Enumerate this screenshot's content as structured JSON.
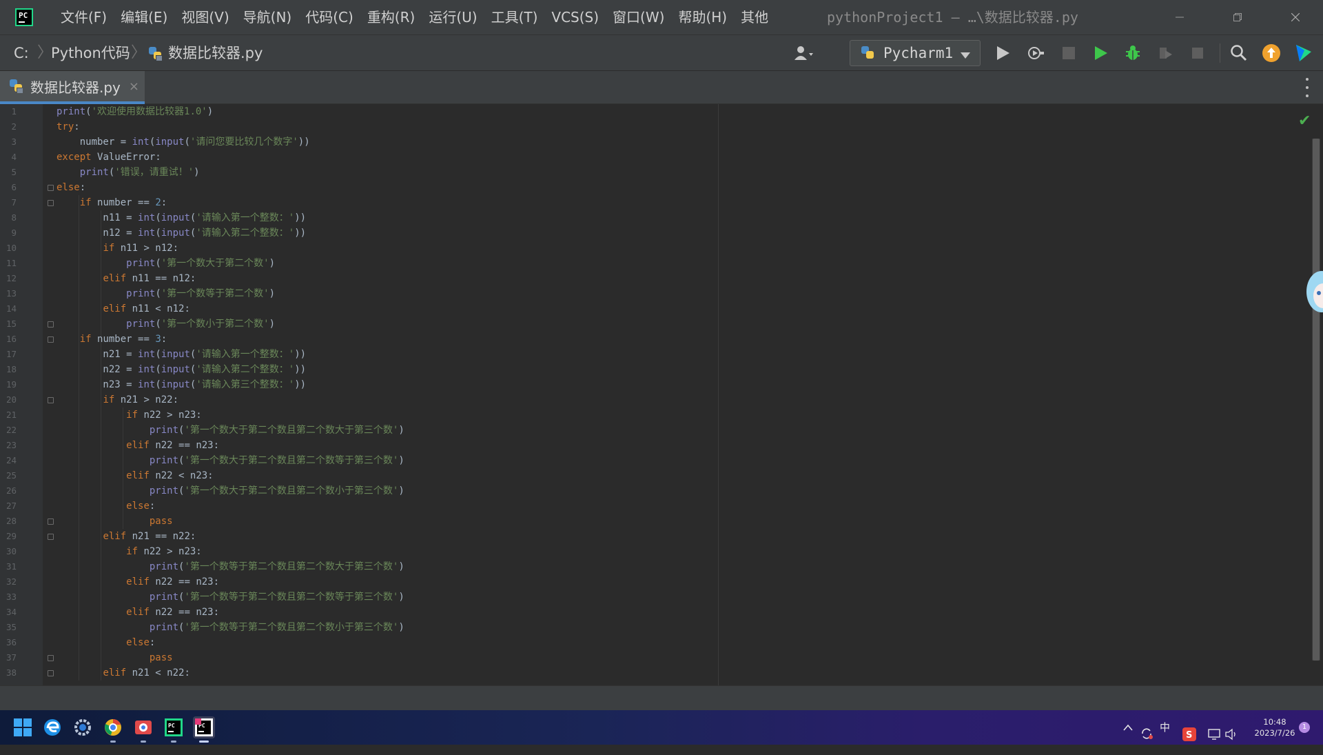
{
  "titlebar": {
    "logo_text": "PC",
    "menu": [
      "文件(F)",
      "编辑(E)",
      "视图(V)",
      "导航(N)",
      "代码(C)",
      "重构(R)",
      "运行(U)",
      "工具(T)",
      "VCS(S)",
      "窗口(W)",
      "帮助(H)",
      "其他"
    ],
    "window_title": "pythonProject1 – …\\数据比较器.py"
  },
  "navbar": {
    "breadcrumb_root": "C:",
    "breadcrumb_folder": "Python代码",
    "breadcrumb_file": "数据比较器.py",
    "run_config": "Pycharm1"
  },
  "tab": {
    "label": "数据比较器.py",
    "close": "×"
  },
  "editor": {
    "line_numbers": [
      "1",
      "2",
      "3",
      "4",
      "5",
      "6",
      "7",
      "8",
      "9",
      "10",
      "11",
      "12",
      "13",
      "14",
      "15",
      "16",
      "17",
      "18",
      "19",
      "20",
      "21",
      "22",
      "23",
      "24",
      "25",
      "26",
      "27",
      "28",
      "29",
      "30",
      "31",
      "32",
      "33",
      "34",
      "35",
      "36",
      "37",
      "38"
    ],
    "lines": [
      [
        [
          "fn",
          "print"
        ],
        [
          "",
          "("
        ],
        [
          "str",
          "'欢迎使用数据比较器1.0'"
        ],
        [
          "",
          ")"
        ]
      ],
      [
        [
          "kw",
          "try"
        ],
        [
          "",
          ":"
        ]
      ],
      [
        [
          "",
          "    number = "
        ],
        [
          "fn",
          "int"
        ],
        [
          "",
          "("
        ],
        [
          "fn",
          "input"
        ],
        [
          "",
          "("
        ],
        [
          "str",
          "'请问您要比较几个数字'"
        ],
        [
          "",
          "))"
        ]
      ],
      [
        [
          "kw",
          "except "
        ],
        [
          "",
          "ValueError:"
        ]
      ],
      [
        [
          "",
          "    "
        ],
        [
          "fn",
          "print"
        ],
        [
          "",
          "("
        ],
        [
          "str",
          "'错误，请重试！'"
        ],
        [
          "",
          ")"
        ]
      ],
      [
        [
          "kw",
          "else"
        ],
        [
          "",
          ":"
        ]
      ],
      [
        [
          "",
          "    "
        ],
        [
          "kw",
          "if "
        ],
        [
          "",
          "number == "
        ],
        [
          "num",
          "2"
        ],
        [
          "",
          ":"
        ]
      ],
      [
        [
          "",
          "        n11 = "
        ],
        [
          "fn",
          "int"
        ],
        [
          "",
          "("
        ],
        [
          "fn",
          "input"
        ],
        [
          "",
          "("
        ],
        [
          "str",
          "'请输入第一个整数：'"
        ],
        [
          "",
          "))"
        ]
      ],
      [
        [
          "",
          "        n12 = "
        ],
        [
          "fn",
          "int"
        ],
        [
          "",
          "("
        ],
        [
          "fn",
          "input"
        ],
        [
          "",
          "("
        ],
        [
          "str",
          "'请输入第二个整数：'"
        ],
        [
          "",
          "))"
        ]
      ],
      [
        [
          "",
          "        "
        ],
        [
          "kw",
          "if "
        ],
        [
          "",
          "n11 > n12:"
        ]
      ],
      [
        [
          "",
          "            "
        ],
        [
          "fn",
          "print"
        ],
        [
          "",
          "("
        ],
        [
          "str",
          "'第一个数大于第二个数'"
        ],
        [
          "",
          ")"
        ]
      ],
      [
        [
          "",
          "        "
        ],
        [
          "kw",
          "elif "
        ],
        [
          "",
          "n11 == n12:"
        ]
      ],
      [
        [
          "",
          "            "
        ],
        [
          "fn",
          "print"
        ],
        [
          "",
          "("
        ],
        [
          "str",
          "'第一个数等于第二个数'"
        ],
        [
          "",
          ")"
        ]
      ],
      [
        [
          "",
          "        "
        ],
        [
          "kw",
          "elif "
        ],
        [
          "",
          "n11 < n12:"
        ]
      ],
      [
        [
          "",
          "            "
        ],
        [
          "fn",
          "print"
        ],
        [
          "",
          "("
        ],
        [
          "str",
          "'第一个数小于第二个数'"
        ],
        [
          "",
          ")"
        ]
      ],
      [
        [
          "",
          "    "
        ],
        [
          "kw",
          "if "
        ],
        [
          "",
          "number == "
        ],
        [
          "num",
          "3"
        ],
        [
          "",
          ":"
        ]
      ],
      [
        [
          "",
          "        n21 = "
        ],
        [
          "fn",
          "int"
        ],
        [
          "",
          "("
        ],
        [
          "fn",
          "input"
        ],
        [
          "",
          "("
        ],
        [
          "str",
          "'请输入第一个整数：'"
        ],
        [
          "",
          "))"
        ]
      ],
      [
        [
          "",
          "        n22 = "
        ],
        [
          "fn",
          "int"
        ],
        [
          "",
          "("
        ],
        [
          "fn",
          "input"
        ],
        [
          "",
          "("
        ],
        [
          "str",
          "'请输入第二个整数：'"
        ],
        [
          "",
          "))"
        ]
      ],
      [
        [
          "",
          "        n23 = "
        ],
        [
          "fn",
          "int"
        ],
        [
          "",
          "("
        ],
        [
          "fn",
          "input"
        ],
        [
          "",
          "("
        ],
        [
          "str",
          "'请输入第三个整数：'"
        ],
        [
          "",
          "))"
        ]
      ],
      [
        [
          "",
          "        "
        ],
        [
          "kw",
          "if "
        ],
        [
          "",
          "n21 > n22:"
        ]
      ],
      [
        [
          "",
          "            "
        ],
        [
          "kw",
          "if "
        ],
        [
          "",
          "n22 > n23:"
        ]
      ],
      [
        [
          "",
          "                "
        ],
        [
          "fn",
          "print"
        ],
        [
          "",
          "("
        ],
        [
          "str",
          "'第一个数大于第二个数且第二个数大于第三个数'"
        ],
        [
          "",
          ")"
        ]
      ],
      [
        [
          "",
          "            "
        ],
        [
          "kw",
          "elif "
        ],
        [
          "",
          "n22 == n23:"
        ]
      ],
      [
        [
          "",
          "                "
        ],
        [
          "fn",
          "print"
        ],
        [
          "",
          "("
        ],
        [
          "str",
          "'第一个数大于第二个数且第二个数等于第三个数'"
        ],
        [
          "",
          ")"
        ]
      ],
      [
        [
          "",
          "            "
        ],
        [
          "kw",
          "elif "
        ],
        [
          "",
          "n22 < n23:"
        ]
      ],
      [
        [
          "",
          "                "
        ],
        [
          "fn",
          "print"
        ],
        [
          "",
          "("
        ],
        [
          "str",
          "'第一个数大于第二个数且第二个数小于第三个数'"
        ],
        [
          "",
          ")"
        ]
      ],
      [
        [
          "",
          "            "
        ],
        [
          "kw",
          "else"
        ],
        [
          "",
          ":"
        ]
      ],
      [
        [
          "",
          "                "
        ],
        [
          "kw",
          "pass"
        ]
      ],
      [
        [
          "",
          "        "
        ],
        [
          "kw",
          "elif "
        ],
        [
          "",
          "n21 == n22:"
        ]
      ],
      [
        [
          "",
          "            "
        ],
        [
          "kw",
          "if "
        ],
        [
          "",
          "n22 > n23:"
        ]
      ],
      [
        [
          "",
          "                "
        ],
        [
          "fn",
          "print"
        ],
        [
          "",
          "("
        ],
        [
          "str",
          "'第一个数等于第二个数且第二个数大于第三个数'"
        ],
        [
          "",
          ")"
        ]
      ],
      [
        [
          "",
          "            "
        ],
        [
          "kw",
          "elif "
        ],
        [
          "",
          "n22 == n23:"
        ]
      ],
      [
        [
          "",
          "                "
        ],
        [
          "fn",
          "print"
        ],
        [
          "",
          "("
        ],
        [
          "str",
          "'第一个数等于第二个数且第二个数等于第三个数'"
        ],
        [
          "",
          ")"
        ]
      ],
      [
        [
          "",
          "            "
        ],
        [
          "kw",
          "elif "
        ],
        [
          "",
          "n22 == n23:"
        ]
      ],
      [
        [
          "",
          "                "
        ],
        [
          "fn",
          "print"
        ],
        [
          "",
          "("
        ],
        [
          "str",
          "'第一个数等于第二个数且第二个数小于第三个数'"
        ],
        [
          "",
          ")"
        ]
      ],
      [
        [
          "",
          "            "
        ],
        [
          "kw",
          "else"
        ],
        [
          "",
          ":"
        ]
      ],
      [
        [
          "",
          "                "
        ],
        [
          "kw",
          "pass"
        ]
      ],
      [
        [
          "",
          "        "
        ],
        [
          "kw",
          "elif "
        ],
        [
          "",
          "n21 < n22:"
        ]
      ]
    ]
  },
  "taskbar": {
    "apps": [
      "windows-start-icon",
      "edge-browser-icon",
      "settings-icon",
      "chrome-icon",
      "photos-icon",
      "pycharm-icon",
      "pycharm-ce-icon"
    ],
    "tray_ime": "中",
    "clock_time": "10:48",
    "clock_date": "2023/7/26",
    "notification_count": "1"
  },
  "colors": {
    "keyword": "#cc7832",
    "builtin": "#8888c6",
    "string": "#6a8759",
    "number": "#6897bb",
    "text": "#a9b7c6",
    "run_green": "#3ec74b",
    "update_orange": "#f0a22e"
  }
}
